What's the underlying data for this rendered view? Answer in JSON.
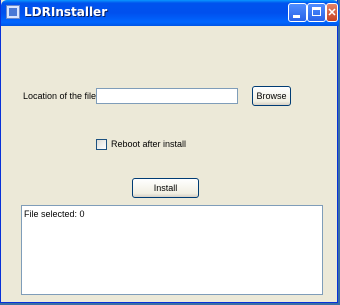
{
  "window": {
    "title": "LDRInstaller",
    "minimize_glyph": "",
    "maximize_glyph": "",
    "close_glyph": "✕"
  },
  "form": {
    "location_label": "Location of the file",
    "location_value": "",
    "browse_label": "Browse",
    "reboot_label": "Reboot after install",
    "reboot_checked": false,
    "install_label": "Install"
  },
  "output": {
    "text": "File selected: 0"
  },
  "colors": {
    "titlebar": "#0053ee",
    "window_bg": "#ece9d8",
    "input_border": "#7f9db9",
    "button_border": "#003c74",
    "close_button": "#c7411f"
  }
}
